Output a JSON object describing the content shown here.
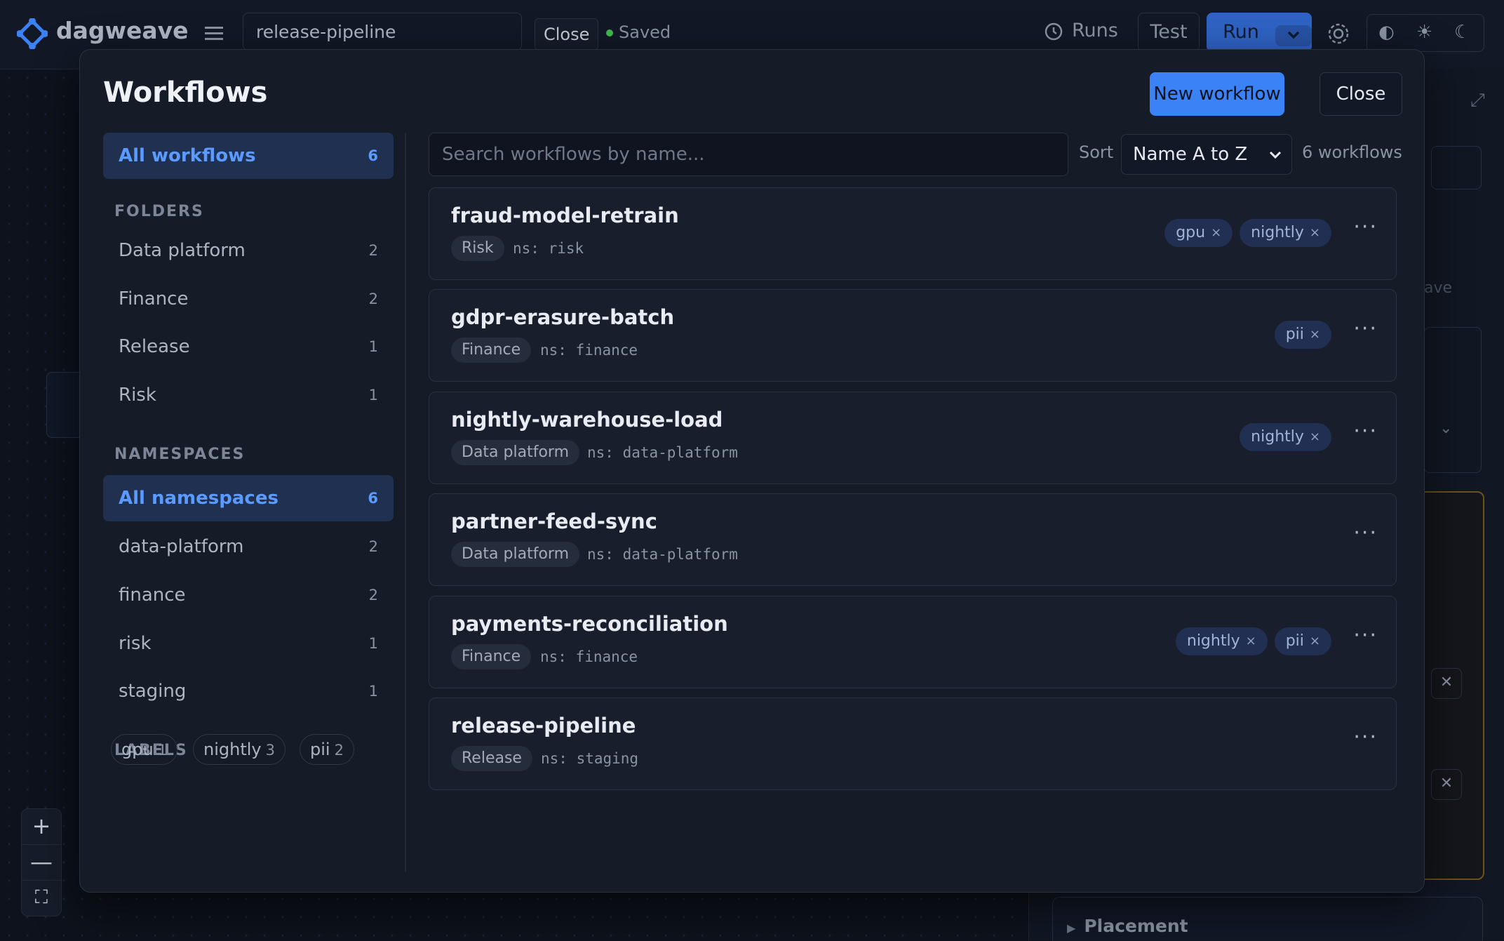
{
  "topbar": {
    "brand": "dagweave",
    "document_name": "release-pipeline",
    "close_label": "Close",
    "saved_label": "Saved",
    "runs_label": "Runs",
    "test_label": "Test",
    "run_label": "Run",
    "theme_icons": [
      "contrast-icon",
      "sun-icon",
      "moon-icon"
    ],
    "theme_glyphs": [
      "◐",
      "☀",
      "☾"
    ]
  },
  "right_panel": {
    "snippet_text": "ave",
    "placement_label": "Placement"
  },
  "modal": {
    "title": "Workflows",
    "new_workflow_label": "New workflow",
    "close_label": "Close",
    "search_placeholder": "Search workflows by name...",
    "sort_label": "Sort",
    "sort_value": "Name A to Z",
    "count_label": "6 workflows"
  },
  "sidebar": {
    "all_workflows": {
      "label": "All workflows",
      "count": "6"
    },
    "folders_heading": "FOLDERS",
    "folders": [
      {
        "label": "Data platform",
        "count": "2"
      },
      {
        "label": "Finance",
        "count": "2"
      },
      {
        "label": "Release",
        "count": "1"
      },
      {
        "label": "Risk",
        "count": "1"
      }
    ],
    "namespaces_heading": "NAMESPACES",
    "all_namespaces": {
      "label": "All namespaces",
      "count": "6"
    },
    "namespaces": [
      {
        "label": "data-platform",
        "count": "2"
      },
      {
        "label": "finance",
        "count": "2"
      },
      {
        "label": "risk",
        "count": "1"
      },
      {
        "label": "staging",
        "count": "1"
      }
    ],
    "labels_heading": "LABELS",
    "labels": [
      {
        "label": "gpu",
        "count": "1"
      },
      {
        "label": "nightly",
        "count": "3"
      },
      {
        "label": "pii",
        "count": "2"
      }
    ]
  },
  "workflows": [
    {
      "name": "fraud-model-retrain",
      "folder": "Risk",
      "ns": "ns: risk",
      "labels": [
        "gpu",
        "nightly"
      ]
    },
    {
      "name": "gdpr-erasure-batch",
      "folder": "Finance",
      "ns": "ns: finance",
      "labels": [
        "pii"
      ]
    },
    {
      "name": "nightly-warehouse-load",
      "folder": "Data platform",
      "ns": "ns: data-platform",
      "labels": [
        "nightly"
      ]
    },
    {
      "name": "partner-feed-sync",
      "folder": "Data platform",
      "ns": "ns: data-platform",
      "labels": []
    },
    {
      "name": "payments-reconciliation",
      "folder": "Finance",
      "ns": "ns: finance",
      "labels": [
        "nightly",
        "pii"
      ]
    },
    {
      "name": "release-pipeline",
      "folder": "Release",
      "ns": "ns: staging",
      "labels": []
    }
  ],
  "colors": {
    "accent": "#3b82f6",
    "active_bg": "#1f3050",
    "saved_dot": "#3fb950"
  }
}
